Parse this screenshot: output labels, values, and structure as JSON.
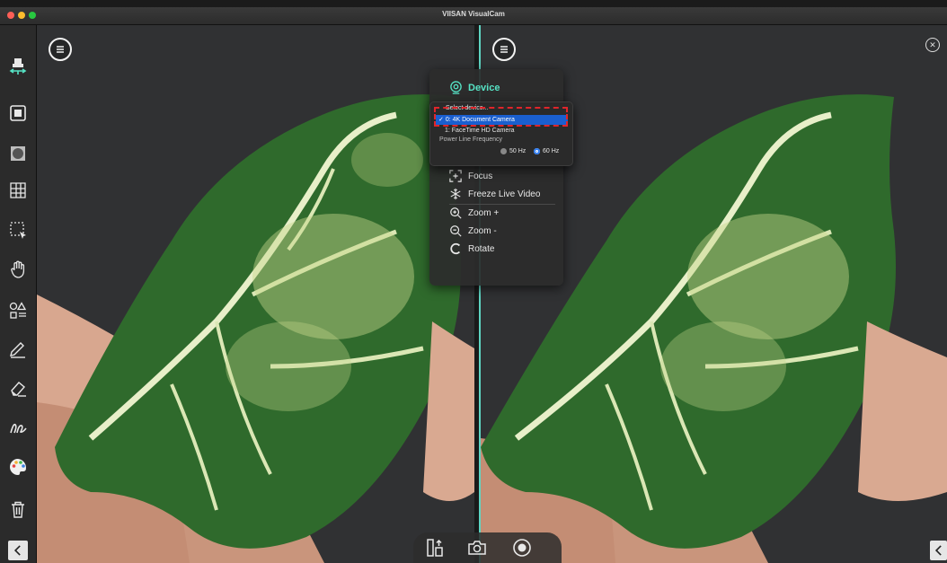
{
  "window": {
    "title": "VIISAN VisualCam"
  },
  "toolbar": {
    "tools": [
      {
        "name": "camera-device-tool",
        "icon": "usb-camera-icon",
        "active": true
      },
      {
        "name": "stop-tool",
        "icon": "square-icon"
      },
      {
        "name": "crop-tool",
        "icon": "crop-icon"
      },
      {
        "name": "grid-tool",
        "icon": "grid-icon"
      },
      {
        "name": "select-area-tool",
        "icon": "selection-icon"
      },
      {
        "name": "pan-hand-tool",
        "icon": "hand-icon"
      },
      {
        "name": "shapes-tool",
        "icon": "shapes-icon"
      },
      {
        "name": "pen-tool",
        "icon": "pencil-icon"
      },
      {
        "name": "eraser-tool",
        "icon": "eraser-icon"
      },
      {
        "name": "curve-tool",
        "icon": "curve-icon"
      },
      {
        "name": "color-palette-tool",
        "icon": "palette-icon"
      },
      {
        "name": "delete-tool",
        "icon": "trash-icon"
      }
    ],
    "collapse": "chevron-left-icon"
  },
  "menu": {
    "device_label": "Device",
    "items": [
      {
        "label": "Focus",
        "icon": "focus-icon"
      },
      {
        "label": "Freeze Live Video",
        "icon": "snowflake-icon"
      },
      {
        "label": "Zoom +",
        "icon": "zoom-in-icon"
      },
      {
        "label": "Zoom -",
        "icon": "zoom-out-icon"
      },
      {
        "label": "Rotate",
        "icon": "rotate-icon"
      }
    ]
  },
  "device_dropdown": {
    "header": "Select device...",
    "options": [
      {
        "label": "0: 4K Document Camera",
        "selected": true,
        "check": "✓"
      },
      {
        "label": "1: FaceTime HD Camera",
        "selected": false
      }
    ],
    "power_line_label": "Power Line Frequency",
    "frequencies": [
      {
        "label": "50 Hz",
        "selected": false
      },
      {
        "label": "60 Hz",
        "selected": true
      }
    ]
  },
  "colors": {
    "accent": "#56e3c5",
    "selection": "#1a5fcf",
    "highlight_box": "#e0242a",
    "divider": "#5ed4c2"
  },
  "bottom_bar": {
    "buttons": [
      "split-layout-icon",
      "camera-capture-icon",
      "record-icon"
    ]
  }
}
